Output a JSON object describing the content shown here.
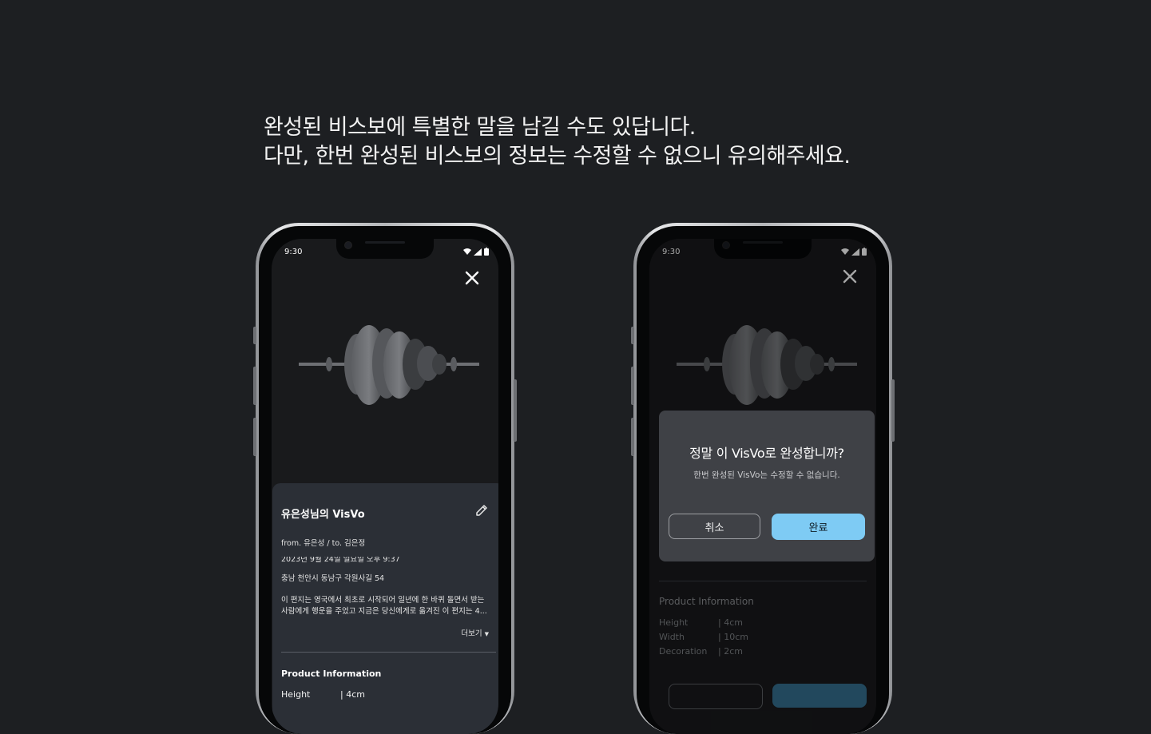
{
  "headline": {
    "line1": "완성된 비스보에 특별한 말을 남길 수도 있답니다.",
    "line2": "다만, 한번 완성된 비스보의 정보는 수정할 수 없으니 유의해주세요."
  },
  "status_time": "9:30",
  "left_phone": {
    "card_title": "유은성님의 VisVo",
    "from_to": "from. 유은성 / to. 김은정",
    "datetime": "2023년 9월 24일 일요일 오후 9:37",
    "address": "충남 천안시 동남구 각원사길 54",
    "message_line1": "이 편지는 영국에서 최초로 시작되어 일년에 한 바퀴 돌면서 받는",
    "message_line2": "사람에게 행운을 주었고 지금은 당신에게로 옮겨진 이 편지는 4...",
    "more_label": "더보기",
    "product_info_title": "Product Information",
    "rows": [
      {
        "label": "Height",
        "value": "| 4cm"
      }
    ]
  },
  "right_phone": {
    "dialog_title": "정말 이 VisVo로 완성합니까?",
    "dialog_subtitle": "한번 완성된 VisVo는 수정할 수 없습니다.",
    "cancel_label": "취소",
    "confirm_label": "완료",
    "product_info_title": "Product Information",
    "rows": [
      {
        "label": "Height",
        "value": "| 4cm"
      },
      {
        "label": "Width",
        "value": "| 10cm"
      },
      {
        "label": "Decoration",
        "value": "| 2cm"
      }
    ]
  },
  "colors": {
    "background": "#1d1f22",
    "confirm_accent": "#7ecbf4",
    "card": "#2b2f36"
  }
}
